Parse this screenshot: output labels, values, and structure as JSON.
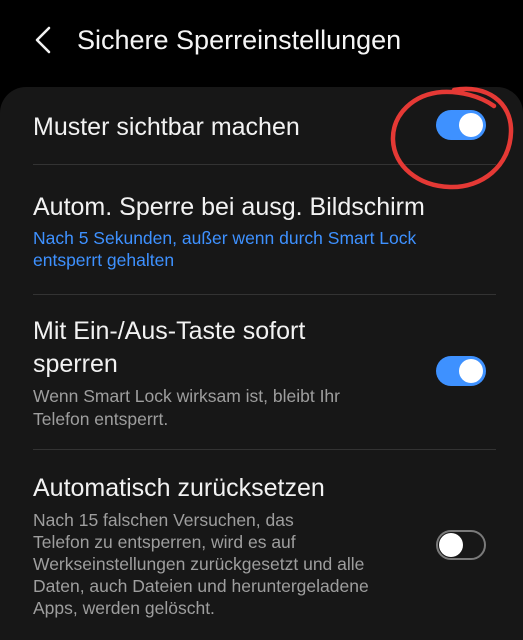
{
  "header": {
    "title": "Sichere Sperreinstellungen",
    "back_icon": "chevron-left-icon"
  },
  "settings": [
    {
      "title": "Muster sichtbar machen",
      "toggle_on": true
    },
    {
      "title": "Autom. Sperre bei ausg. Bildschirm",
      "subtitle_line1": "Nach 5 Sekunden, außer wenn durch Smart Lock",
      "subtitle_line2": "entsperrt gehalten"
    },
    {
      "title_line1": "Mit Ein-/Aus-Taste sofort",
      "title_line2": "sperren",
      "subtitle_line1": "Wenn Smart Lock wirksam ist, bleibt Ihr",
      "subtitle_line2": "Telefon entsperrt.",
      "toggle_on": true
    },
    {
      "title": "Automatisch zurücksetzen",
      "subtitle_line1": "Nach 15 falschen Versuchen, das",
      "subtitle_line2": "Telefon zu entsperren, wird es auf",
      "subtitle_line3": "Werkseinstellungen zurückgesetzt und alle",
      "subtitle_line4": "Daten, auch Dateien und heruntergeladene",
      "subtitle_line5": "Apps, werden gelöscht.",
      "toggle_on": false
    }
  ],
  "colors": {
    "background": "#000000",
    "card": "#171717",
    "accent": "#3e91ff",
    "secondary_text": "#9e9e9e",
    "annotation": "#e53935"
  }
}
